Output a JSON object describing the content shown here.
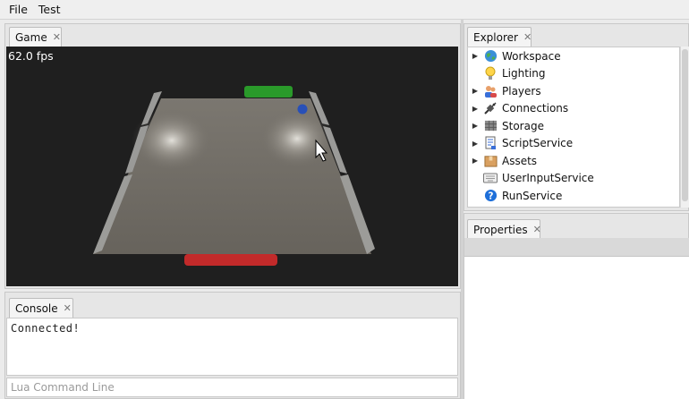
{
  "menu": {
    "file": "File",
    "test": "Test"
  },
  "game": {
    "tab_label": "Game",
    "fps": "62.0 fps",
    "colors": {
      "floor": "#6f6b64",
      "wall": "#8c8c8a",
      "paddle_top": "#2a9a2a",
      "paddle_bottom": "#c22a2a",
      "ball": "#2850b8"
    }
  },
  "console": {
    "tab_label": "Console",
    "output": "Connected!",
    "input_placeholder": "Lua Command Line"
  },
  "explorer": {
    "tab_label": "Explorer",
    "items": [
      {
        "label": "Workspace",
        "expandable": true,
        "icon": "globe-icon"
      },
      {
        "label": "Lighting",
        "expandable": false,
        "icon": "lightbulb-icon"
      },
      {
        "label": "Players",
        "expandable": true,
        "icon": "players-icon"
      },
      {
        "label": "Connections",
        "expandable": true,
        "icon": "plug-icon"
      },
      {
        "label": "Storage",
        "expandable": true,
        "icon": "storage-icon"
      },
      {
        "label": "ScriptService",
        "expandable": true,
        "icon": "script-icon"
      },
      {
        "label": "Assets",
        "expandable": true,
        "icon": "box-icon"
      },
      {
        "label": "UserInputService",
        "expandable": false,
        "icon": "keyboard-icon"
      },
      {
        "label": "RunService",
        "expandable": false,
        "icon": "help-icon"
      }
    ]
  },
  "properties": {
    "tab_label": "Properties"
  }
}
